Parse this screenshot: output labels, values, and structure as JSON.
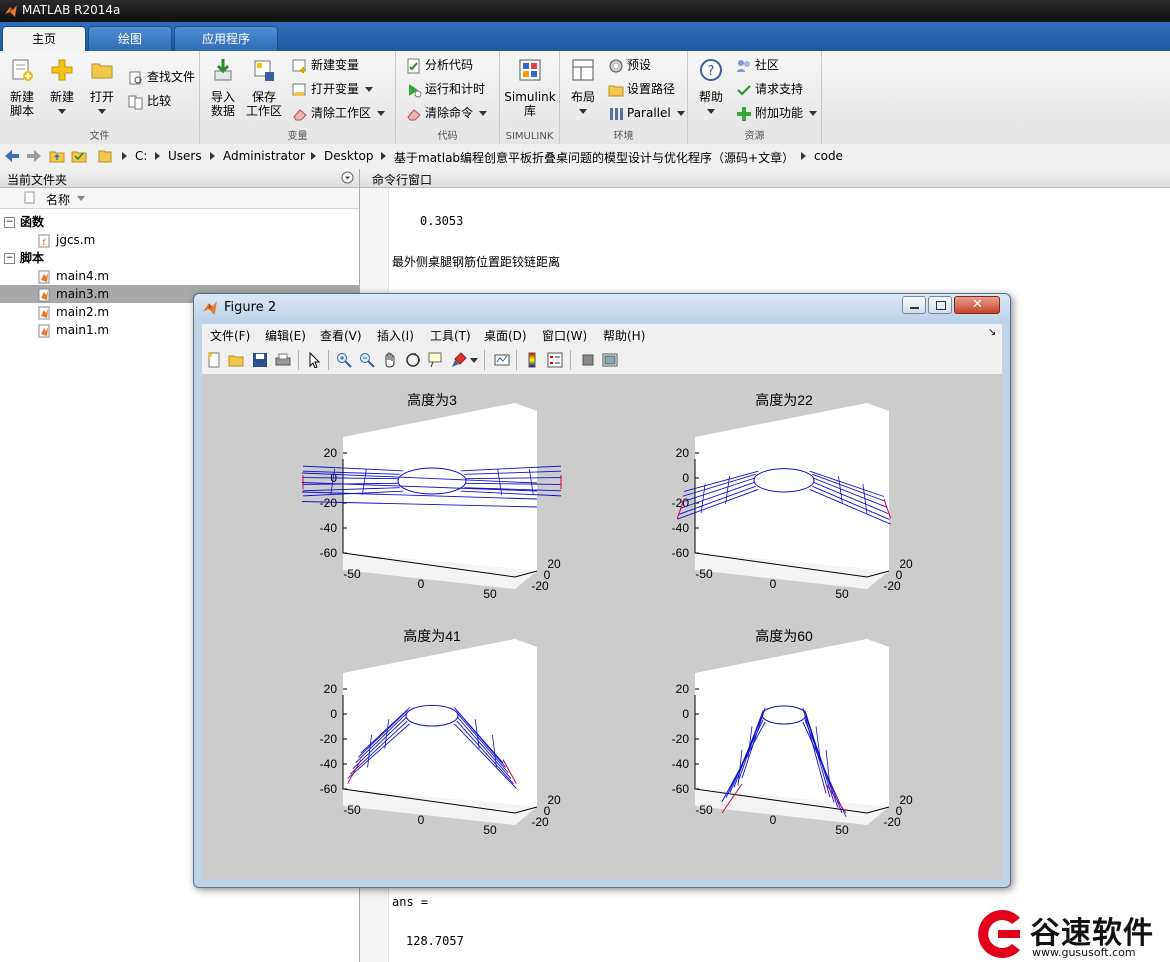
{
  "window": {
    "title": "MATLAB R2014a"
  },
  "tabs": [
    {
      "label": "主页",
      "active": true
    },
    {
      "label": "绘图",
      "active": false
    },
    {
      "label": "应用程序",
      "active": false
    }
  ],
  "ribbon": {
    "file": {
      "label": "文件",
      "new_script": "新建\n脚本",
      "new": "新建",
      "open": "打开",
      "find_files": "查找文件",
      "compare": "比较"
    },
    "variable": {
      "label": "变量",
      "import": "导入\n数据",
      "save": "保存\n工作区",
      "new_var": "新建变量",
      "open_var": "打开变量",
      "clear_ws": "清除工作区"
    },
    "code": {
      "label": "代码",
      "analyze": "分析代码",
      "run_time": "运行和计时",
      "clear_cmd": "清除命令"
    },
    "simulink": {
      "label": "SIMULINK",
      "lib": "Simulink\n库"
    },
    "env": {
      "label": "环境",
      "layout": "布局",
      "prefs": "预设",
      "set_path": "设置路径",
      "parallel": "Parallel"
    },
    "resources": {
      "label": "资源",
      "help": "帮助",
      "community": "社区",
      "support": "请求支持",
      "addons": "附加功能"
    }
  },
  "address": [
    "C:",
    "Users",
    "Administrator",
    "Desktop",
    "基于matlab编程创意平板折叠桌问题的模型设计与优化程序（源码+文章）",
    "code"
  ],
  "left_panel": {
    "title": "当前文件夹",
    "col_name": "名称",
    "groups": [
      {
        "label": "函数",
        "files": [
          "jgcs.m"
        ]
      },
      {
        "label": "脚本",
        "files": [
          "main4.m",
          "main3.m",
          "main2.m",
          "main1.m"
        ]
      }
    ]
  },
  "cmd": {
    "title": "命令行窗口",
    "value1": "0.3053",
    "line1": "最外侧桌腿钢筋位置距铰链距离",
    "ans_label": "ans =",
    "ans_value": "128.7057"
  },
  "figure": {
    "title": "Figure 2",
    "menus": [
      "文件(F)",
      "编辑(E)",
      "查看(V)",
      "插入(I)",
      "工具(T)",
      "桌面(D)",
      "窗口(W)",
      "帮助(H)"
    ]
  },
  "chart_data": [
    {
      "type": "surface-3d",
      "title": "高度为3",
      "z_ticks": [
        20,
        0,
        -20,
        -40,
        -60
      ],
      "x_ticks": [
        -50,
        0,
        50
      ],
      "y_ticks": [
        -20,
        0,
        20
      ],
      "height": 3
    },
    {
      "type": "surface-3d",
      "title": "高度为22",
      "z_ticks": [
        20,
        0,
        -20,
        -40,
        -60
      ],
      "x_ticks": [
        -50,
        0,
        50
      ],
      "y_ticks": [
        -20,
        0,
        20
      ],
      "height": 22
    },
    {
      "type": "surface-3d",
      "title": "高度为41",
      "z_ticks": [
        20,
        0,
        -20,
        -40,
        -60
      ],
      "x_ticks": [
        -50,
        0,
        50
      ],
      "y_ticks": [
        -20,
        0,
        20
      ],
      "height": 41
    },
    {
      "type": "surface-3d",
      "title": "高度为60",
      "z_ticks": [
        20,
        0,
        -20,
        -40,
        -60
      ],
      "x_ticks": [
        -50,
        0,
        50
      ],
      "y_ticks": [
        -20,
        0,
        20
      ],
      "height": 60
    }
  ],
  "watermark": {
    "brand": "谷速软件",
    "url": "www.gususoft.com"
  }
}
